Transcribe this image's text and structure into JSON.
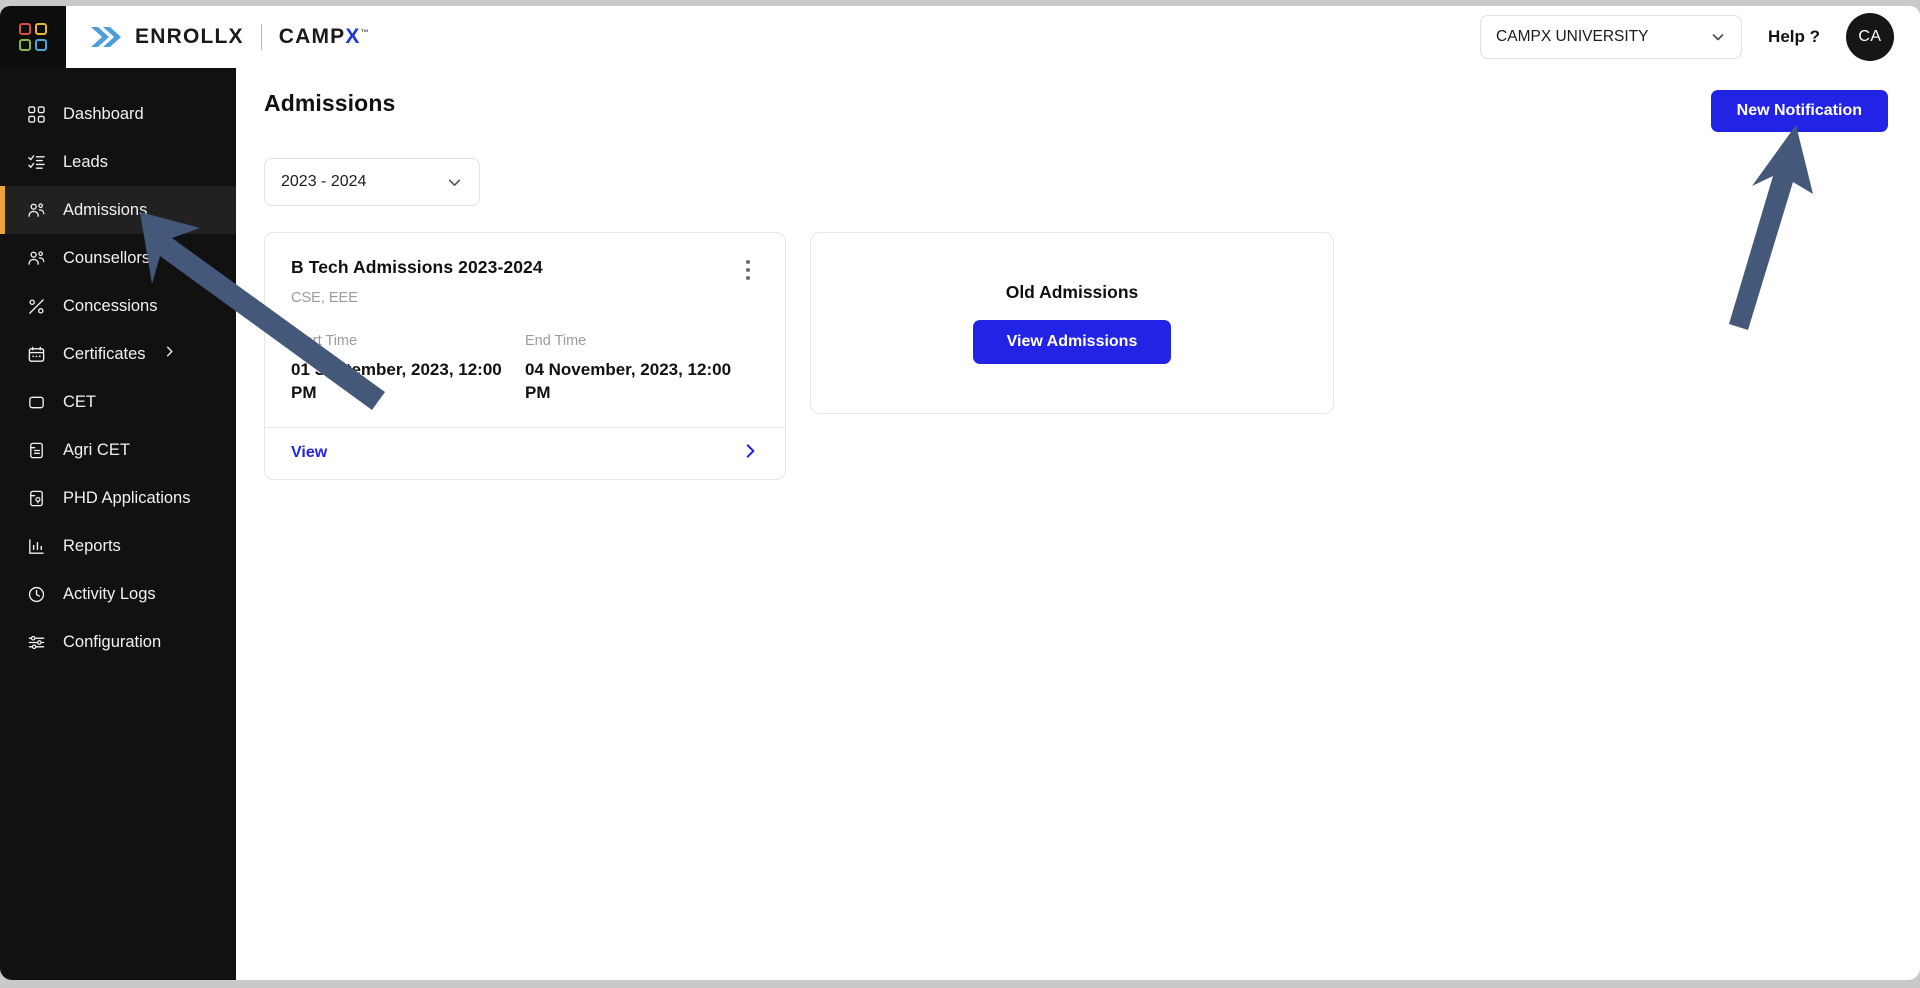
{
  "brand": {
    "logo_icon": "four-circles-grid-icon",
    "chevron_icon": "double-chevron-icon",
    "enrollx": "ENROLLX",
    "campx_prefix": "CAMP",
    "campx_x": "X",
    "campx_tm": "™"
  },
  "topbar": {
    "organization_selected": "CAMPX UNIVERSITY",
    "organization_caret_icon": "chevron-down-icon",
    "help_label": "Help ?",
    "avatar_initials": "CA"
  },
  "sidebar": {
    "items": [
      {
        "label": "Dashboard",
        "icon": "grid-icon",
        "active": false,
        "has_submenu": false
      },
      {
        "label": "Leads",
        "icon": "list-check-icon",
        "active": false,
        "has_submenu": false
      },
      {
        "label": "Admissions",
        "icon": "users-icon",
        "active": true,
        "has_submenu": false
      },
      {
        "label": "Counsellors",
        "icon": "users-icon",
        "active": false,
        "has_submenu": false
      },
      {
        "label": "Concessions",
        "icon": "percent-icon",
        "active": false,
        "has_submenu": false
      },
      {
        "label": "Certificates",
        "icon": "calendar-icon",
        "active": false,
        "has_submenu": true
      },
      {
        "label": "CET",
        "icon": "square-icon",
        "active": false,
        "has_submenu": false
      },
      {
        "label": "Agri CET",
        "icon": "document-icon",
        "active": false,
        "has_submenu": false
      },
      {
        "label": "PHD Applications",
        "icon": "doc-lock-icon",
        "active": false,
        "has_submenu": false
      },
      {
        "label": "Reports",
        "icon": "bar-chart-icon",
        "active": false,
        "has_submenu": false
      },
      {
        "label": "Activity Logs",
        "icon": "clock-icon",
        "active": false,
        "has_submenu": false
      },
      {
        "label": "Configuration",
        "icon": "sliders-icon",
        "active": false,
        "has_submenu": false
      }
    ],
    "active_accent_color": "#e8a33d"
  },
  "main": {
    "page_title": "Admissions",
    "new_notification_label": "New Notification",
    "year_filter": {
      "selected": "2023 - 2024",
      "caret_icon": "chevron-down-icon"
    },
    "admission_card": {
      "title": "B Tech Admissions 2023-2024",
      "subtitle": "CSE, EEE",
      "menu_icon": "kebab-menu-icon",
      "start_label": "Start Time",
      "start_value": "01 September, 2023, 12:00 PM",
      "end_label": "End Time",
      "end_value": "04 November, 2023, 12:00 PM",
      "view_label": "View",
      "view_chevron_icon": "chevron-right-icon"
    },
    "old_admissions": {
      "title": "Old Admissions",
      "button_label": "View Admissions"
    }
  },
  "colors": {
    "primary_blue": "#2323e6",
    "sidebar_bg": "#111111",
    "accent_amber": "#e8a33d",
    "annotation_arrow": "#44597a"
  },
  "annotations": [
    {
      "name": "arrow-to-admissions-nav",
      "points_to": "Admissions"
    },
    {
      "name": "arrow-to-new-notification",
      "points_to": "New Notification"
    }
  ]
}
